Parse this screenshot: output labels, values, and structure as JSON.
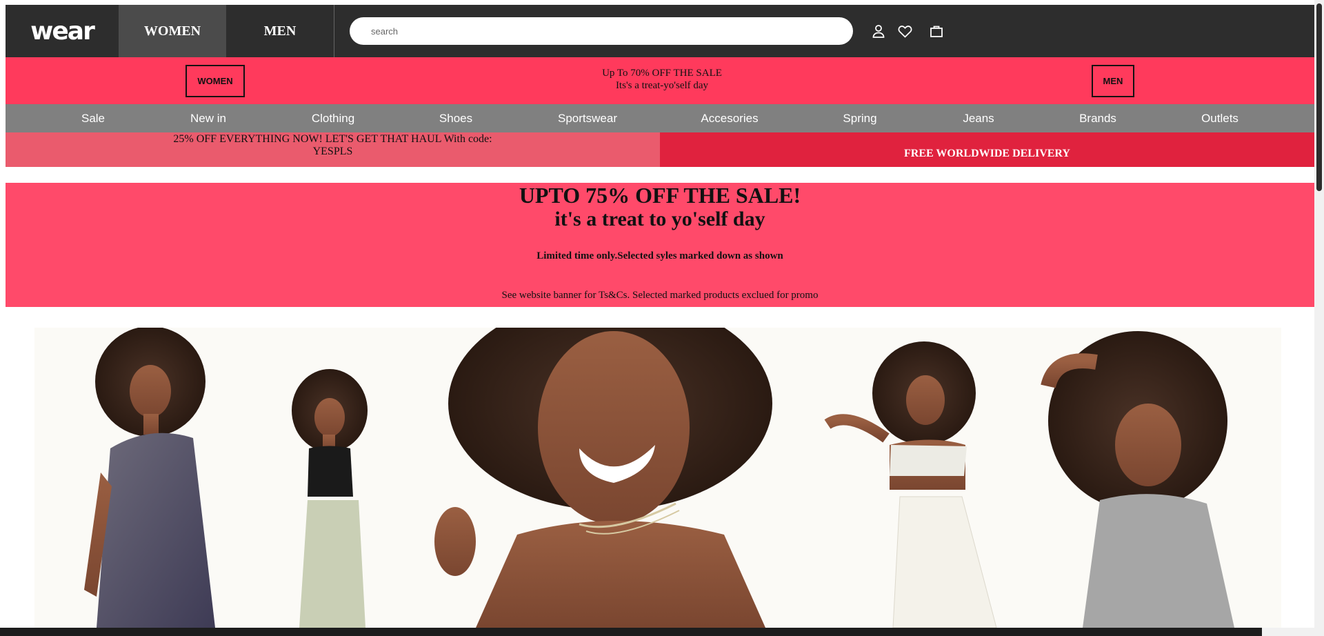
{
  "header": {
    "logo": "wear",
    "tab_women": "WOMEN",
    "tab_men": "MEN",
    "search_placeholder": "search",
    "icons": [
      "account-icon",
      "heart-icon",
      "bag-icon"
    ]
  },
  "promo": {
    "women_button": "WOMEN",
    "men_button": "MEN",
    "line1": "Up To 70% OFF THE SALE",
    "line2": "Its's a treat-yo'self day"
  },
  "nav": {
    "items": [
      "Sale",
      "New in",
      "Clothing",
      "Shoes",
      "Sportswear",
      "Accesories",
      "Spring",
      "Jeans",
      "Brands",
      "Outlets"
    ]
  },
  "offers": {
    "left_line1": "25% OFF EVERYTHING NOW! LET'S GET THAT HAUL With code:",
    "left_line2": "YESPLS",
    "right": "FREE WORLDWIDE DELIVERY"
  },
  "sale_banner": {
    "headline": "UPTO 75% OFF THE SALE!",
    "subheadline": "it's a treat to yo'self day",
    "note": "Limited time only.Selected syles marked down as shown",
    "terms": "See website banner for Ts&Cs. Selected marked products exclued for promo"
  },
  "colors": {
    "topbar": "#2d2d2d",
    "promo": "#ff3a5c",
    "nav": "#808080",
    "offer_left": "#ea5b6d",
    "offer_right": "#e0223e",
    "sale_banner": "#ff4a6a"
  }
}
